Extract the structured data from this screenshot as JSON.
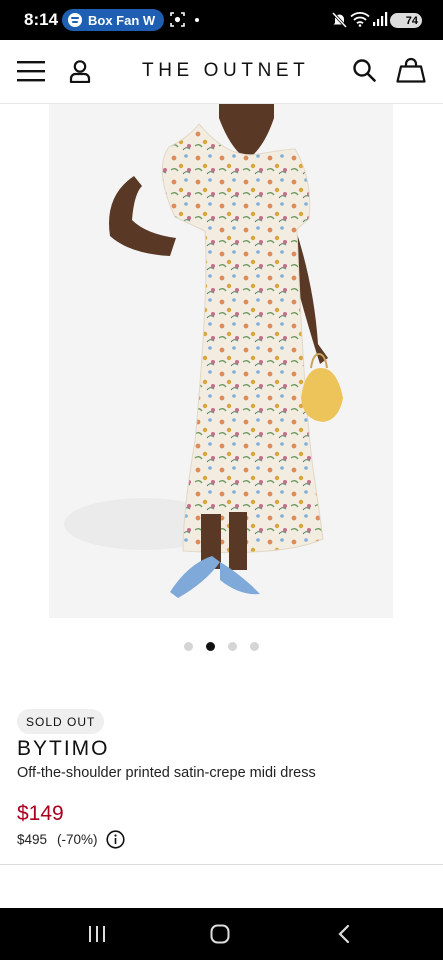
{
  "status_bar": {
    "time": "8:14",
    "media_app_text": "Box Fan W",
    "battery": "74"
  },
  "header": {
    "brand": "THE OUTNET"
  },
  "carousel": {
    "total": 4,
    "active_index": 1
  },
  "product": {
    "badge": "SOLD OUT",
    "designer": "BYTIMO",
    "description": "Off-the-shoulder printed satin-crepe midi dress",
    "sale_price": "$149",
    "original_price": "$495",
    "discount": "(-70%)"
  },
  "colors": {
    "sale_price": "#a8001e",
    "status_bar": "#000000",
    "media_pill": "#1e5fb4"
  },
  "icons": [
    "menu-icon",
    "account-icon",
    "search-icon",
    "shopping-bag-icon",
    "info-icon",
    "recents-icon",
    "home-icon",
    "back-icon"
  ]
}
